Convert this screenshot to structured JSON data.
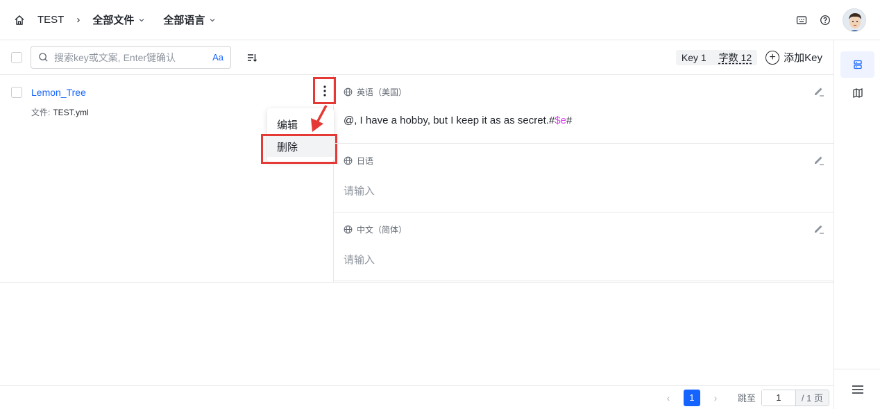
{
  "header": {
    "project": "TEST",
    "separator": "›",
    "files_dropdown": "全部文件",
    "lang_dropdown": "全部语言"
  },
  "toolbar": {
    "search_placeholder": "搜索key或文案, Enter键确认",
    "case_toggle": "Aa",
    "key_count": "Key 1",
    "word_count": "字数 12",
    "add_key": "添加Key",
    "add_icon": "+"
  },
  "key_item": {
    "name": "Lemon_Tree",
    "file_label": "文件:",
    "file_value": "TEST.yml"
  },
  "menu": {
    "edit": "编辑",
    "delete": "删除"
  },
  "translations": [
    {
      "lang": "英语（美国）",
      "text_before": "@, I have a hobby, but I keep it as as secret.#",
      "var": "$e",
      "text_after": "#"
    },
    {
      "lang": "日语",
      "placeholder": "请输入"
    },
    {
      "lang": "中文（简体）",
      "placeholder": "请输入"
    }
  ],
  "pagination": {
    "prev": "‹",
    "current": "1",
    "next": "›",
    "jump_label": "跳至",
    "jump_value": "1",
    "total": "/ 1 页"
  },
  "colors": {
    "accent": "#1664ff",
    "highlight": "#e53935",
    "variable": "#d946ef"
  }
}
